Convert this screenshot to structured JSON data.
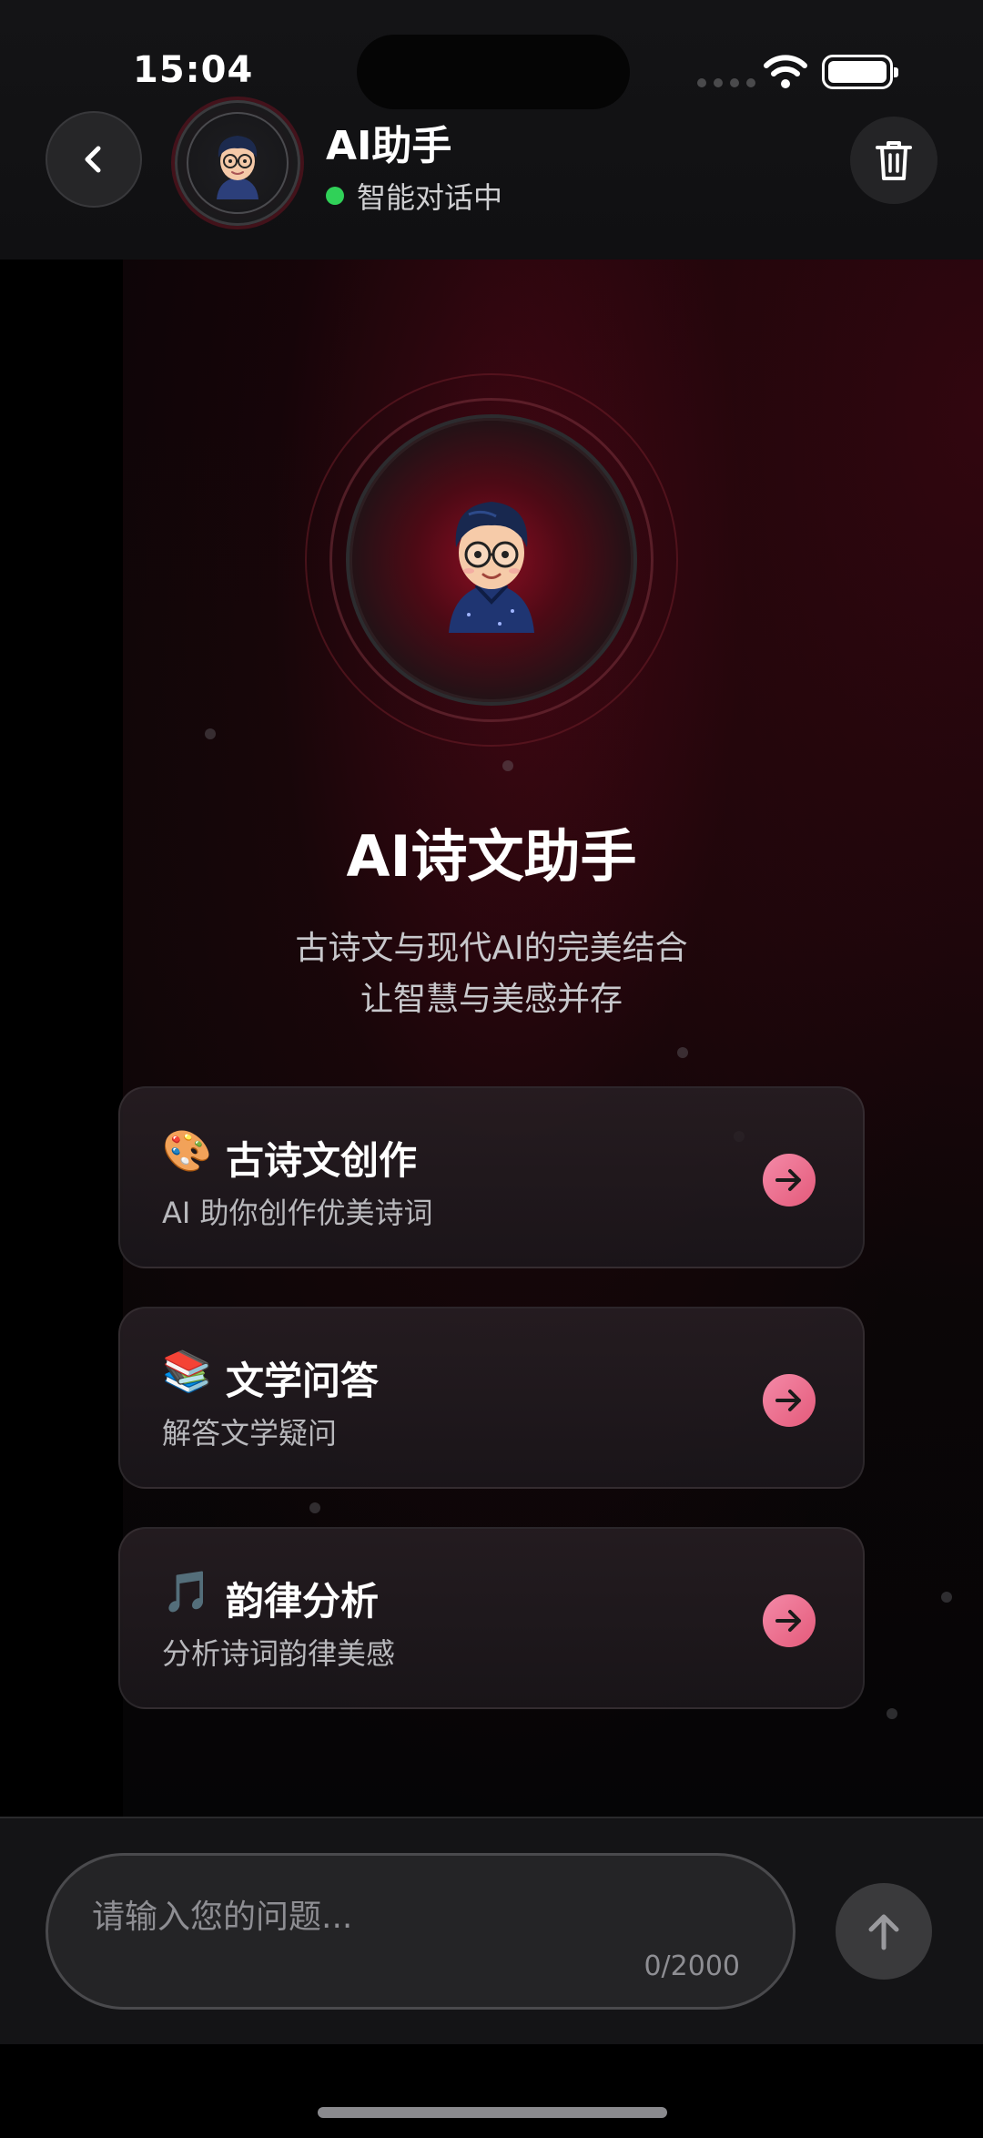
{
  "status_bar": {
    "time": "15:04"
  },
  "header": {
    "title": "AI助手",
    "status": "智能对话中",
    "status_color": "#30d158",
    "back_icon": "chevron-left-icon",
    "trash_icon": "trash-icon"
  },
  "hero": {
    "title": "AI诗文助手",
    "subtitle_line1": "古诗文与现代AI的完美结合",
    "subtitle_line2": "让智慧与美感并存"
  },
  "cards": [
    {
      "emoji": "🎨",
      "icon": "palette-icon",
      "title": "古诗文创作",
      "desc": "AI 助你创作优美诗词"
    },
    {
      "emoji": "📚",
      "icon": "books-icon",
      "title": "文学问答",
      "desc": "解答文学疑问"
    },
    {
      "emoji": "🎵",
      "icon": "music-note-icon",
      "title": "韵律分析",
      "desc": "分析诗词韵律美感"
    }
  ],
  "input": {
    "placeholder": "请输入您的问题...",
    "counter": "0/2000",
    "send_icon": "arrow-up-icon"
  },
  "colors": {
    "accent_pink": "#e45a7a",
    "background": "#000000",
    "card_bg": "#221c20"
  }
}
